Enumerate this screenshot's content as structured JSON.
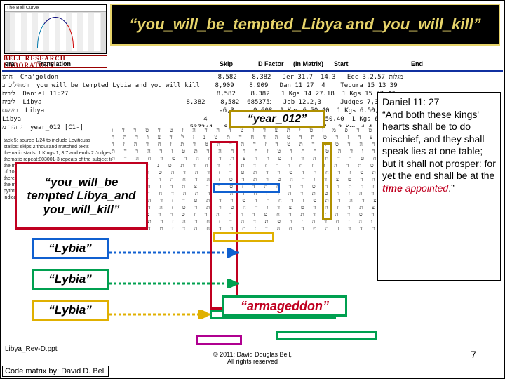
{
  "header": {
    "chart_title": "The Bell Curve",
    "lab_label": "BELL RESEARCH LABORATORY",
    "title_html": "“you_will_be_tempted_Libya and_you_will_kill”"
  },
  "table": {
    "headers": {
      "era": "era",
      "trans": "Translation",
      "skip": "Skip",
      "df": "D Factor",
      "im": "(in Matrix)",
      "st": "Start",
      "en": "End"
    },
    "row1": "חרגן  Cha'goldon                                          8,582    8.382   Jer 31.7  14.3   Ecc מגלות 3.2.57",
    "row2": "רמחילוכחב  you_will_be_tempted_Lybia_and_you_will_kill    8,909    8.909   Dan 11 27  4    Tecura 15 13 39",
    "row3": "ליביח  Daniel 11:27                                       8,582    8.382   1 Kgs 14 27.18  1 Kgs 15 22 47",
    "row4": "ליביח  Libya                                      נ685375  8,582    8.382   Job 12.2,3     Judges 7,3 85",
    "row5": "בששס  Libya                                              -6,3    -0.608  1 Kgs 6.50,40  1 Kgs 6.50,50",
    "row6": "Libya                                                4       8.382   0.505   1 Kgs 6.50,40  1 Kgs 6.50,41",
    "row7": "יחהידדמ  year_012 [C1-]                           -5372/4  -8.382  -5.274  2 Kgs 2.19,7   2 Kgs 4.4.15"
  },
  "notes": "tack 5: source 1/24 to include Leviticuss\nstatics: skips 2 thousand matched texts\nthematic starts, 1 Kings 1, 3:7 and ends 2 Judges 7, 3:51;\nthematic repeat:803001-3 repeats of the subject text;\nthe matrix has 34 rows, it is 51 columns wide and contains a total of 1003 characters\nthere are 2 qualifiers in the matrix\nthe matrix starts at 2 Kgs 2! 10861057353345/5.03 in Levs of pythrerc\nindicator of  tevhnotaal hyhqashua 10/4",
  "callouts": {
    "main": "“you_will_be tempted Libya_and you_will_kill”",
    "lybia": "“Lybia”",
    "year": "“year_012”",
    "armageddon": "“armageddon”"
  },
  "verse": {
    "ref": "Daniel 11: 27",
    "body_pre": "“And both these kings' hearts shall be to do mischief, and they shall speak lies at one table; but it shall not prosper: for yet the end shall be at the ",
    "em1": "time",
    "em2": "appointed",
    "body_post": ".”"
  },
  "footer": {
    "left": "Libya_Rev-D.ppt",
    "mid1": "© 2011; David Douglas Bell,",
    "mid2": "All rights reserved",
    "right": "7",
    "credit": "Code matrix by: David D. Bell"
  },
  "matrix_filler": "ח ר ד ו צ ת ה ז ד י ט ד פ מ ז ט י\nת צ ד ז ט ד ה ד ה ז ט ד ט ר ד ו צ\nד ה ח ה ז ד ת ד ט צ ד ז ר ט ת ד ט\nה ד ח ד ת ט נ ז ל ד צ ו ד ה ר ת ד\nצ ד ה ד ת ט ז ד ח ה ד ט ר ד ת ט ד\nז ד ה ד ה ט ד ת ז ח ד ה ז ד ת ד צ\nת ד ז ה ד ט צ ד ו ד ה ט ר ת ד ט ז\nה ד ח ה ד ת ט ז ד ה ר ד ת צ ה ד ט\nד ה ז ד ת ד ח ט ד ד ח ה ד ז ט ר ד\nצ ת ד ז ה ד ט ד ח ה ד ת ט ד ו ה ז\nח ד ה ז ד ט ת ד ה ד ז ח ד ה ז ד ת\nה ד ח ד ת ט נ ז ל ד צ ו ד ה ר ת ד\nצ ד ה ד ת ט ז ד ח ה ד ט ר ד ת ט ד\nז ד ה ד ה ט ד ת ז ח ד ה ז ד ת ד צ\nת ד ז ה ד ט צ ד ו ד ה ט ר ת ד ט ז\nה ד ח ה ד ת ט ז ד ה ר ד ת צ ה ד ט\nד ה ז ד ת ד ח ט ד ד ח ה ד ז ט ר ד\nצ ת ד ז ה ד ט ד ח ה ד ת ט ד ו ה ז\nח ד ה ז ד ט ת ד ה ד ז ח ד ה ז ד ת\nה ד ח ד ת ט נ ז ל ד צ ו ד ה ר ת ד\nצ ד ה ד ת ט ז ד ח ה ד ט ר ד ת ט ד\nז ד ה ד ה ט ד ת ז ח ד ה ז ד ת ד צ\nת ד ז ה ד ט צ ד ו ד ה ט ר ת ד ט ז\nה ד ח ה ד ת ט ז ד ה ר ד ת צ ה ד ט\nד ה ז ד ת ד ח ט ד ד ח ה ד ז ט ר ד\nצ ת ד ז ה ד ט ד ח ה ד ת ט ד ו ה ז\nח ד ה ז ד ט ת ד ה ד ז ח ד ה ז ד ת\nה ד ת ט ד ש ד ח ה ז ד ת ד ד ז ה ט\nד ח ה ד ז ת ד ד ח ה ד ז ט ד ת ה ד"
}
